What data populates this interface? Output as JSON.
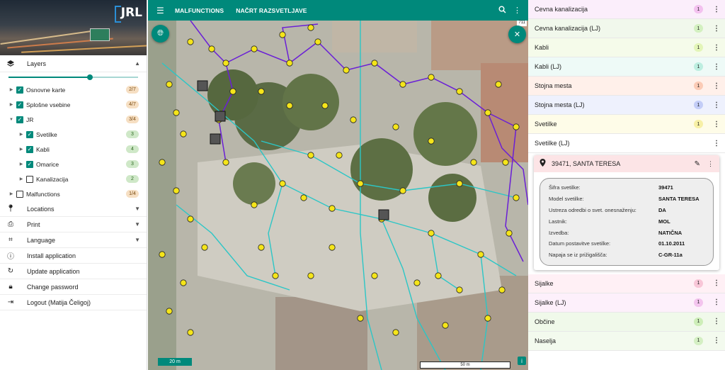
{
  "app": {
    "logo": "JRL"
  },
  "sidebar": {
    "layers_label": "Layers",
    "slider_level": 0.63,
    "tree": [
      {
        "label": "Osnovne karte",
        "badge": "2/7",
        "checked": true,
        "level": 0
      },
      {
        "label": "Splošne vsebine",
        "badge": "4/7",
        "checked": true,
        "level": 0
      },
      {
        "label": "JR",
        "badge": "3/4",
        "checked": true,
        "level": 0,
        "expanded": true
      },
      {
        "label": "Svetilke",
        "badge": "3",
        "checked": true,
        "level": 1
      },
      {
        "label": "Kabli",
        "badge": "4",
        "checked": true,
        "level": 1
      },
      {
        "label": "Omarice",
        "badge": "3",
        "checked": true,
        "level": 1
      },
      {
        "label": "Kanalizacija",
        "badge": "2",
        "checked": false,
        "level": 1
      },
      {
        "label": "Malfunctions",
        "badge": "1/4",
        "checked": false,
        "level": 0
      }
    ],
    "menu": [
      {
        "label": "Locations",
        "icon": "location-pin-icon",
        "chevron": true
      },
      {
        "label": "Print",
        "icon": "print-icon",
        "chevron": true
      },
      {
        "label": "Language",
        "icon": "language-icon",
        "chevron": true
      },
      {
        "label": "Install application",
        "icon": "info-icon",
        "chevron": false
      },
      {
        "label": "Update application",
        "icon": "refresh-icon",
        "chevron": false
      },
      {
        "label": "Change password",
        "icon": "lock-icon",
        "chevron": false
      },
      {
        "label": "Logout (Matija Čeligoj)",
        "icon": "logout-icon",
        "chevron": false
      }
    ]
  },
  "topbar": {
    "tabs": [
      "MALFUNCTIONS",
      "NAČRT RAZSVETLJAVE"
    ]
  },
  "map": {
    "scale_label": "20 m",
    "scalebar_label": "50 m",
    "coord_label": "711"
  },
  "right_panel": {
    "layers_top": [
      {
        "label": "Cevna kanalizacija",
        "count": "1",
        "bg": "#fbeefb",
        "badge": "#f3c1ef"
      },
      {
        "label": "Cevna kanalizacija (LJ)",
        "count": "1",
        "bg": "#f1f8ec",
        "badge": "#d3f0c0"
      },
      {
        "label": "Kabli",
        "count": "1",
        "bg": "#f5fbea",
        "badge": "#e3f5b8"
      },
      {
        "label": "Kabli (LJ)",
        "count": "1",
        "bg": "#eefaf7",
        "badge": "#bdeee0"
      },
      {
        "label": "Stojna mesta",
        "count": "1",
        "bg": "#fff0ea",
        "badge": "#fbcbb6"
      },
      {
        "label": "Stojna mesta (LJ)",
        "count": "1",
        "bg": "#eef1fd",
        "badge": "#c3cdf7"
      },
      {
        "label": "Svetilke",
        "count": "1",
        "bg": "#fefce8",
        "badge": "#f7f0a6"
      },
      {
        "label": "Svetilke (LJ)",
        "count": "",
        "bg": "#ffffff",
        "badge": "#ffffff"
      }
    ],
    "card": {
      "title": "39471, SANTA TERESA",
      "props": [
        {
          "k": "Šifra svetilke:",
          "v": "39471"
        },
        {
          "k": "Model svetilke:",
          "v": "SANTA TERESA"
        },
        {
          "k": "Ustreza odredbi o svet. onesnaženju:",
          "v": "DA"
        },
        {
          "k": "Lastnik:",
          "v": "MOL"
        },
        {
          "k": "Izvedba:",
          "v": "NATIČNA"
        },
        {
          "k": "Datum postavitve svetilke:",
          "v": "01.10.2011"
        },
        {
          "k": "Napaja se iz prižigališča:",
          "v": "C-GR-11a"
        }
      ]
    },
    "layers_bottom": [
      {
        "label": "Sijalke",
        "count": "1",
        "bg": "#fff0f5",
        "badge": "#f8c6d7"
      },
      {
        "label": "Sijalke (LJ)",
        "count": "1",
        "bg": "#fdf0fb",
        "badge": "#f3c4ee"
      },
      {
        "label": "Občine",
        "count": "1",
        "bg": "#f0f9ea",
        "badge": "#cdeeb8"
      },
      {
        "label": "Naselja",
        "count": "1",
        "bg": "#f3faee",
        "badge": "#d4efc3"
      }
    ]
  },
  "colors": {
    "accent": "#00897b",
    "line_purple": "#6a1fd6",
    "line_cyan": "#2bc6c6",
    "marker_yellow": "#f5e51a"
  }
}
